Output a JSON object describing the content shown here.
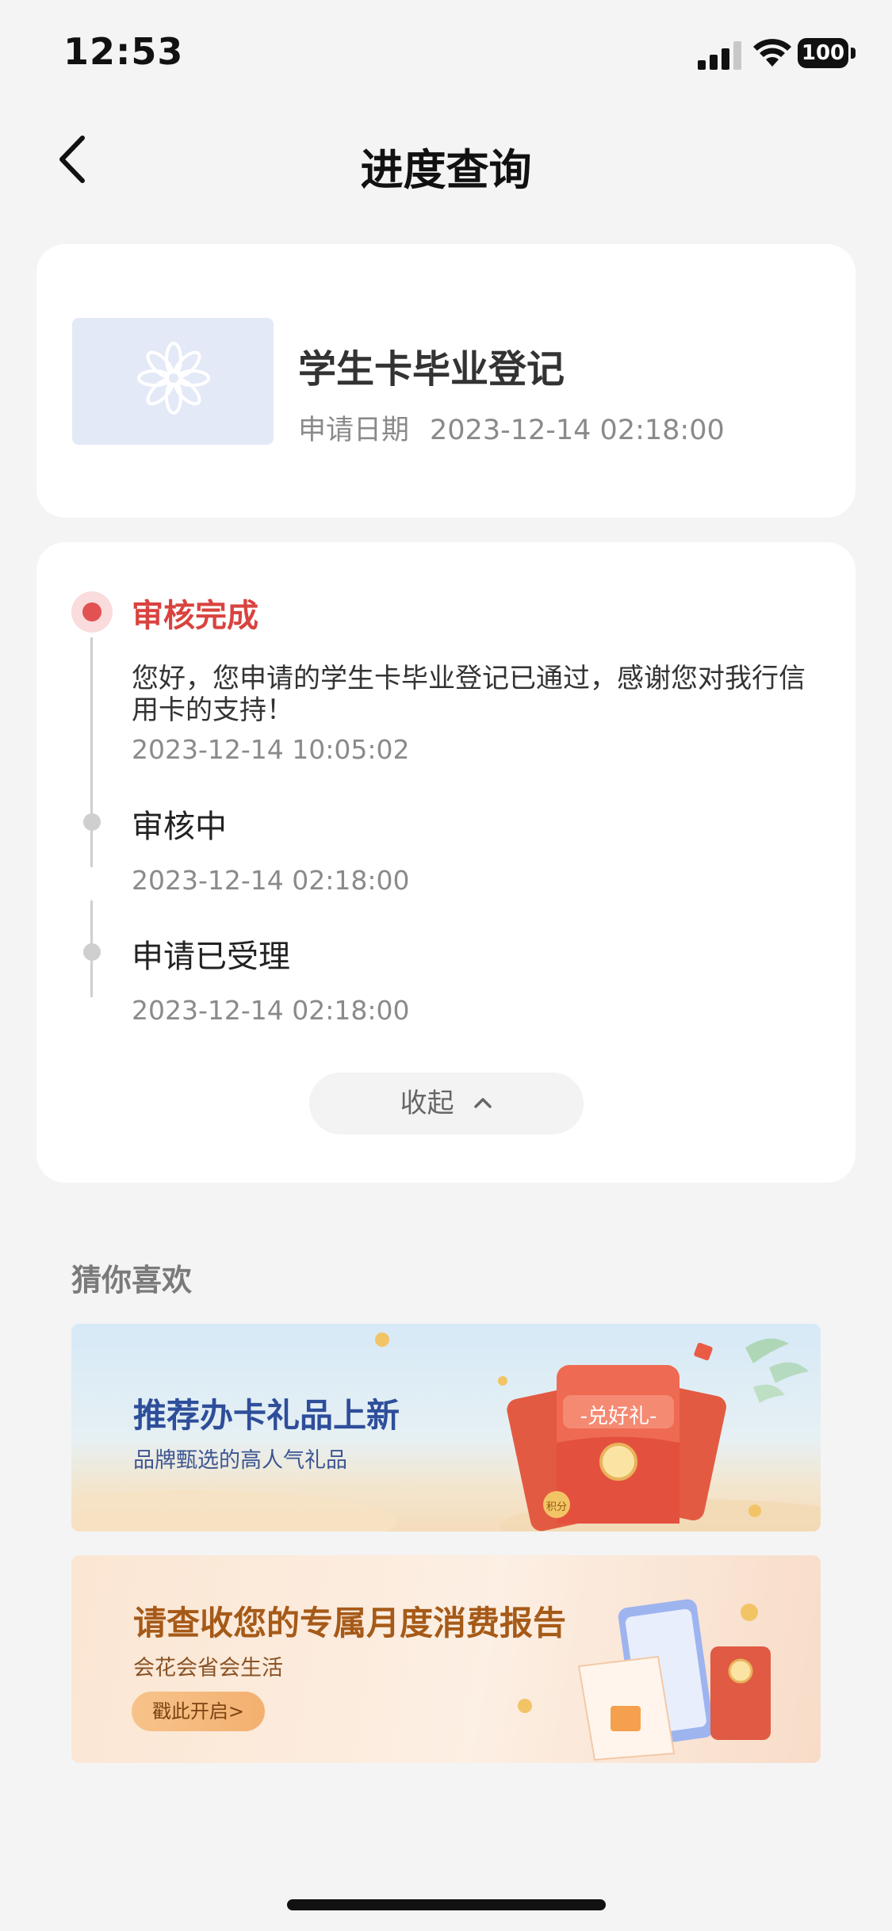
{
  "status_bar": {
    "time": "12:53",
    "battery": "100"
  },
  "nav": {
    "title": "进度查询"
  },
  "application": {
    "title": "学生卡毕业登记",
    "date_label": "申请日期",
    "date_value": "2023-12-14 02:18:00"
  },
  "progress": {
    "steps": [
      {
        "title": "审核完成",
        "description": "您好，您申请的学生卡毕业登记已通过，感谢您对我行信用卡的支持！",
        "time": "2023-12-14 10:05:02",
        "state": "active"
      },
      {
        "title": "审核中",
        "time": "2023-12-14 02:18:00",
        "state": "done"
      },
      {
        "title": "申请已受理",
        "time": "2023-12-14 02:18:00",
        "state": "done"
      }
    ],
    "collapse_label": "收起"
  },
  "recommend": {
    "section_title": "猜你喜欢",
    "banners": [
      {
        "title": "推荐办卡礼品上新",
        "subtitle": "品牌甄选的高人气礼品",
        "badge": "-兑好礼-",
        "coin_label": "积分"
      },
      {
        "title": "请查收您的专属月度消费报告",
        "subtitle": "会花会省会生活",
        "button": "戳此开启>"
      }
    ]
  },
  "colors": {
    "accent": "#d9433f",
    "banner1_title": "#2e4e9a",
    "banner2_title": "#a65a18"
  },
  "icons": [
    "back-chevron-icon",
    "signal-icon",
    "wifi-icon",
    "battery-icon",
    "flower-placeholder-icon",
    "chevron-up-icon"
  ]
}
